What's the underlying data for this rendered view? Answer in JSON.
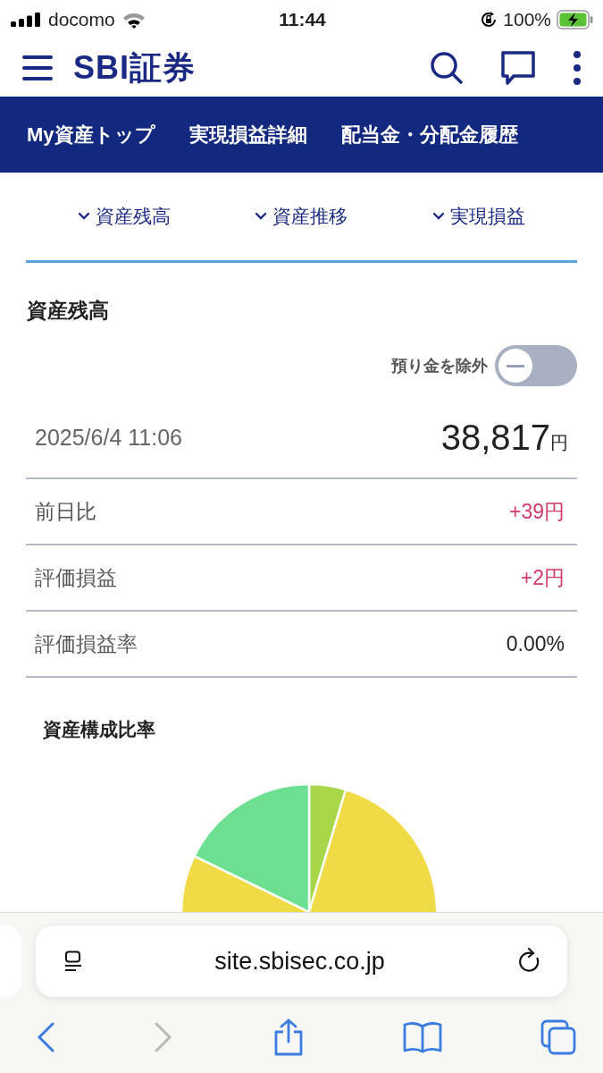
{
  "status_bar": {
    "carrier": "docomo",
    "time": "11:44",
    "battery": "100%"
  },
  "header": {
    "logo": "SBI証券"
  },
  "nav_tabs": [
    {
      "label": "My資産トップ"
    },
    {
      "label": "実現損益詳細"
    },
    {
      "label": "配当金・分配金履歴"
    }
  ],
  "section_links": [
    "資産残高",
    "資産推移",
    "実現損益"
  ],
  "balance": {
    "title": "資産残高",
    "toggle": {
      "label": "預り金を除外",
      "on": false
    },
    "date": "2025/6/4 11:06",
    "amount": "38,817",
    "unit": "円",
    "rows": [
      {
        "label": "前日比",
        "value": "+39円",
        "color": "#d23a67"
      },
      {
        "label": "評価損益",
        "value": "+2円",
        "color": "#d23a67"
      },
      {
        "label": "評価損益率",
        "value": "0.00%",
        "color": "#222222"
      }
    ]
  },
  "composition": {
    "title": "資産構成比率"
  },
  "browser": {
    "url": "site.sbisec.co.jp",
    "forward_disabled": true
  }
}
